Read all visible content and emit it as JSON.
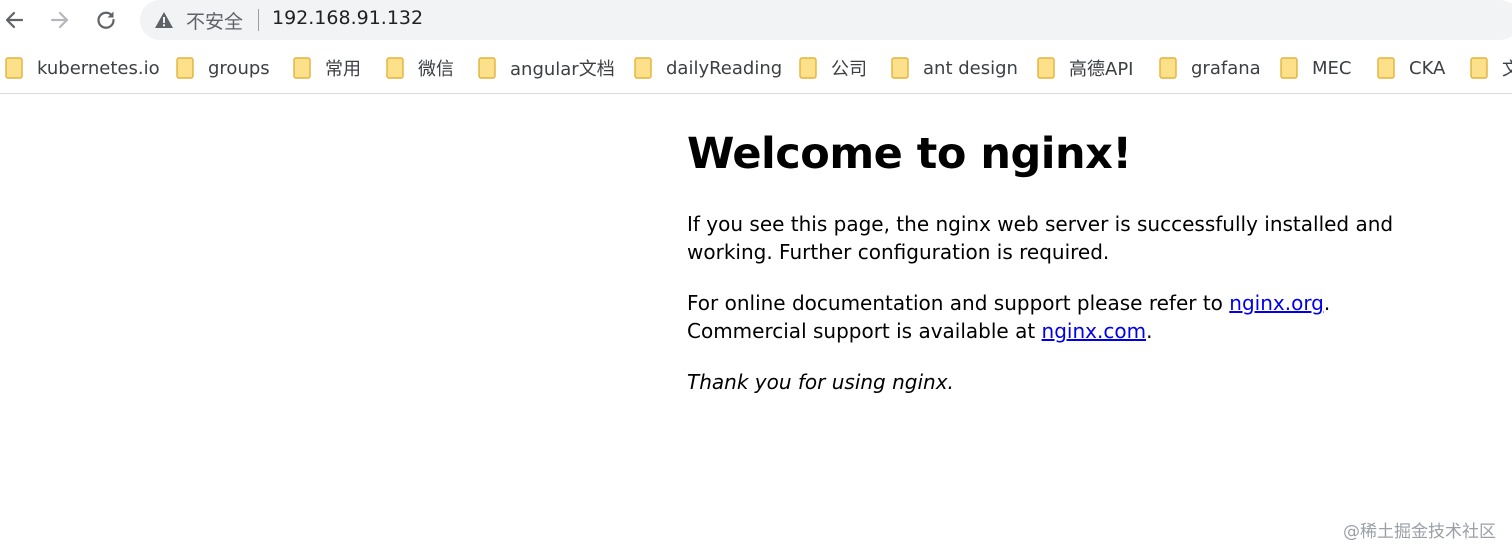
{
  "browser": {
    "security_label": "不安全",
    "url": "192.168.91.132"
  },
  "bookmarks": [
    {
      "label": "kubernetes.io",
      "icon": "folder-icon"
    },
    {
      "label": "groups",
      "icon": "folder-icon"
    },
    {
      "label": "常用",
      "icon": "folder-icon"
    },
    {
      "label": "微信",
      "icon": "folder-icon"
    },
    {
      "label": "angular文档",
      "icon": "folder-icon"
    },
    {
      "label": "dailyReading",
      "icon": "folder-icon"
    },
    {
      "label": "公司",
      "icon": "folder-icon"
    },
    {
      "label": "ant design",
      "icon": "folder-icon"
    },
    {
      "label": "高德API",
      "icon": "folder-icon"
    },
    {
      "label": "grafana",
      "icon": "folder-icon"
    },
    {
      "label": "MEC",
      "icon": "folder-icon"
    },
    {
      "label": "CKA",
      "icon": "folder-icon"
    },
    {
      "label": "文",
      "icon": "folder-icon"
    }
  ],
  "page": {
    "heading": "Welcome to nginx!",
    "para1": "If you see this page, the nginx web server is successfully installed and working. Further configuration is required.",
    "para2_prefix": "For online documentation and support please refer to ",
    "link_org": "nginx.org",
    "para2_mid": ".",
    "para2_line2_prefix": "Commercial support is available at ",
    "link_com": "nginx.com",
    "para2_end": ".",
    "para3": "Thank you for using nginx."
  },
  "watermark": "@稀土掘金技术社区",
  "colors": {
    "link": "#0000ee",
    "folder_fill": "#fce08a",
    "folder_stroke": "#e2b33a",
    "omnibox_bg": "#f1f3f4"
  }
}
